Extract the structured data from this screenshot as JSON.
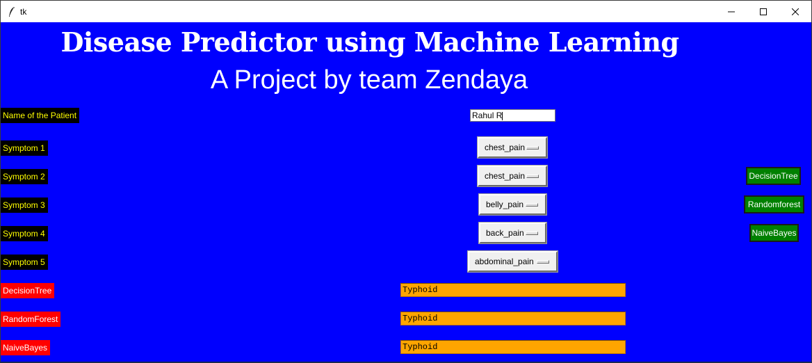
{
  "window": {
    "title": "tk"
  },
  "header": {
    "title": "Disease Predictor using Machine Learning",
    "subtitle": "A Project by team Zendaya"
  },
  "form": {
    "name_label": "Name of the Patient",
    "name_value": "Rahul R",
    "symptoms": [
      {
        "label": "Symptom 1",
        "value": "chest_pain"
      },
      {
        "label": "Symptom 2",
        "value": "chest_pain"
      },
      {
        "label": "Symptom 3",
        "value": "belly_pain"
      },
      {
        "label": "Symptom 4",
        "value": "back_pain"
      },
      {
        "label": "Symptom 5",
        "value": "abdominal_pain"
      }
    ]
  },
  "buttons": {
    "decision_tree": "DecisionTree",
    "random_forest": "Randomforest",
    "naive_bayes": "NaiveBayes"
  },
  "results": [
    {
      "label": "DecisionTree",
      "value": "Typhoid"
    },
    {
      "label": "RandomForest",
      "value": "Typhoid"
    },
    {
      "label": "NaiveBayes",
      "value": "Typhoid"
    }
  ],
  "colors": {
    "background": "#0000fe",
    "label_bg": "#000000",
    "label_text": "#ffff00",
    "result_label_bg": "#ff0000",
    "result_field_bg": "#ffa500",
    "button_bg": "#008000"
  }
}
